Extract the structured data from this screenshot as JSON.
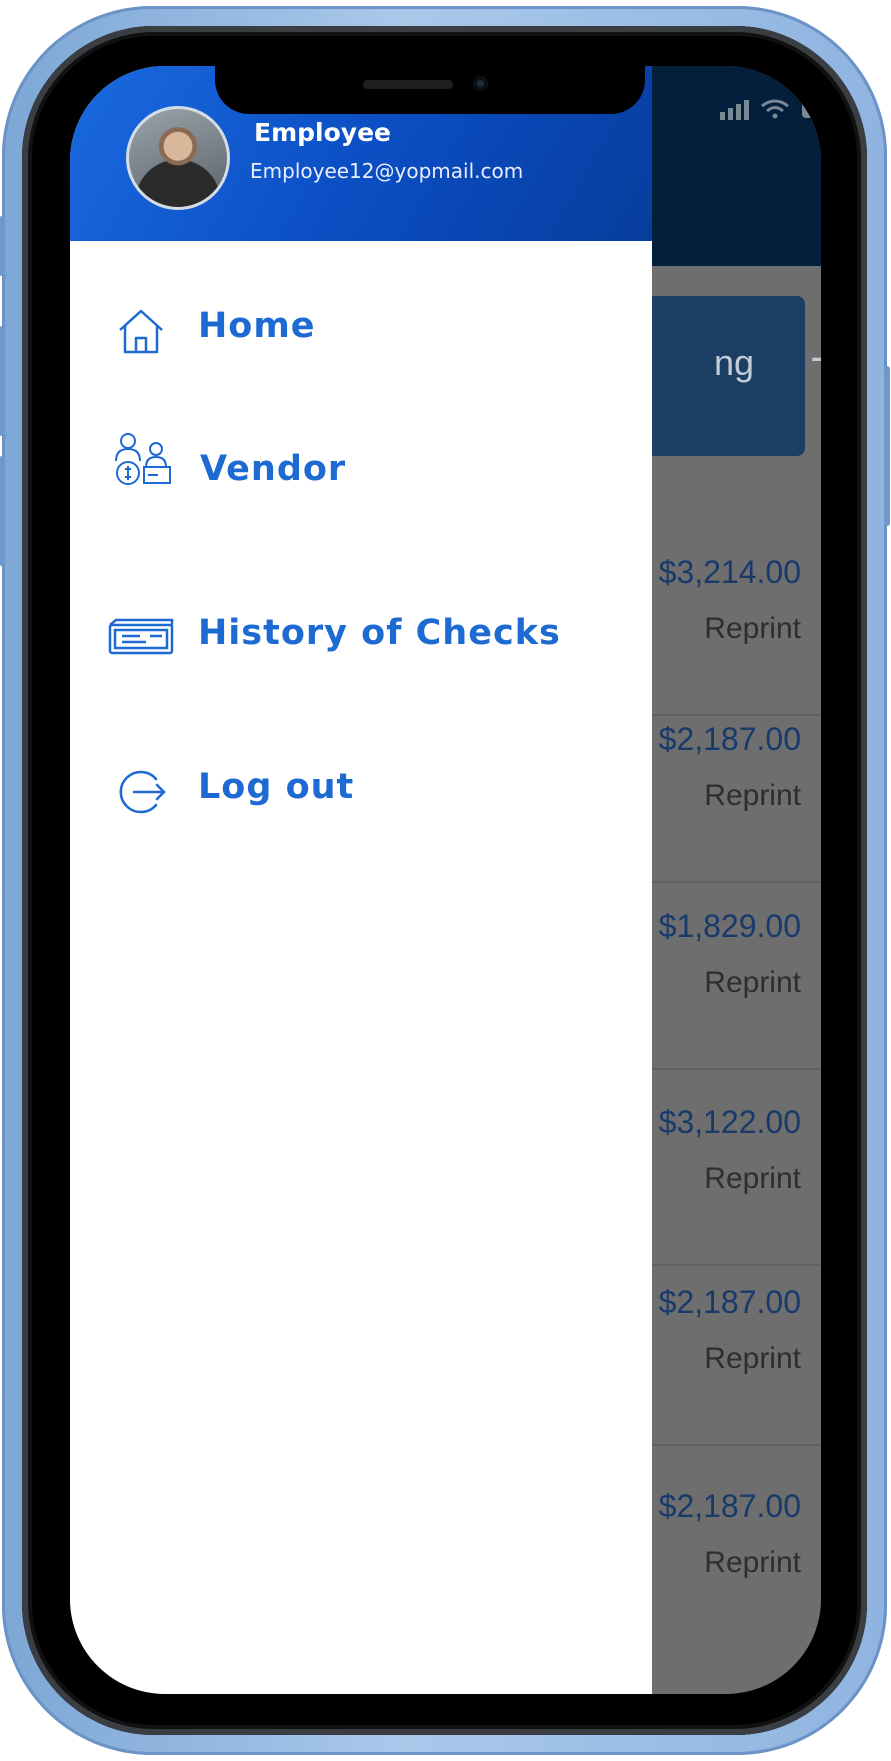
{
  "status_bar": {
    "signal_icon": "signal-bars-icon",
    "wifi_icon": "wifi-icon",
    "battery_icon": "battery-icon"
  },
  "background_app": {
    "card_text_fragment": "ng",
    "card_arrow_icon": "arrow-right-icon",
    "rows": [
      {
        "amount": "$3,214.00",
        "action": "Reprint"
      },
      {
        "amount": "$2,187.00",
        "action": "Reprint"
      },
      {
        "amount": "$1,829.00",
        "action": "Reprint"
      },
      {
        "amount": "$3,122.00",
        "action": "Reprint"
      },
      {
        "amount": "$2,187.00",
        "action": "Reprint"
      },
      {
        "amount": "$2,187.00",
        "action": "Reprint"
      }
    ]
  },
  "drawer": {
    "user": {
      "name": "Employee",
      "email": "Employee12@yopmail.com"
    },
    "menu": [
      {
        "label": "Home",
        "icon": "home-icon"
      },
      {
        "label": "Vendor",
        "icon": "vendor-icon"
      },
      {
        "label": "History of Checks",
        "icon": "check-icon"
      },
      {
        "label": "Log out",
        "icon": "logout-icon"
      }
    ],
    "accent_color": "#1c6ad2",
    "header_color": "#0b4cc1"
  }
}
